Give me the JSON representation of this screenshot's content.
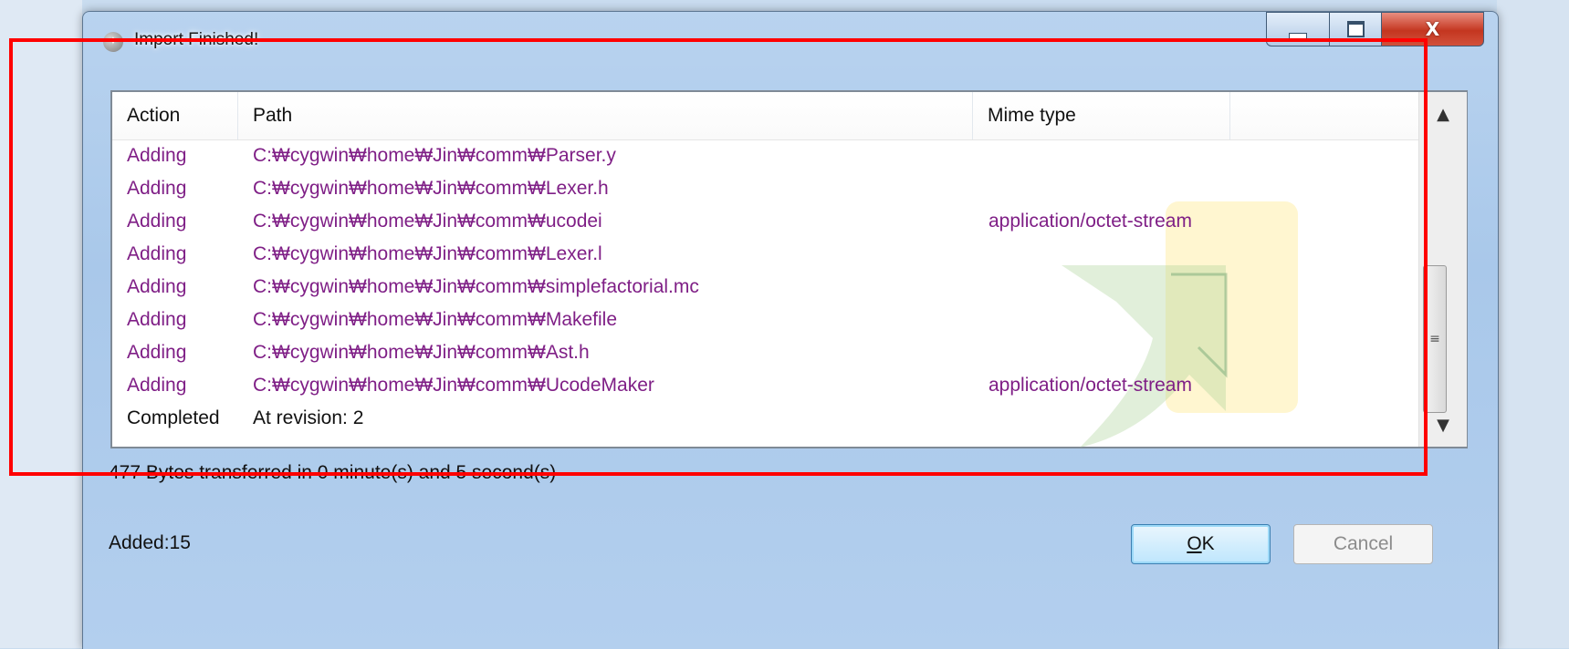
{
  "dialog": {
    "title": "Import Finished!",
    "close_glyph": "X"
  },
  "list": {
    "columns": [
      "Action",
      "Path",
      "Mime type"
    ],
    "rows": [
      {
        "action": "Adding",
        "path": "C:₩cygwin₩home₩Jin₩comm₩Parser.y",
        "mime": ""
      },
      {
        "action": "Adding",
        "path": "C:₩cygwin₩home₩Jin₩comm₩Lexer.h",
        "mime": ""
      },
      {
        "action": "Adding",
        "path": "C:₩cygwin₩home₩Jin₩comm₩ucodei",
        "mime": "application/octet-stream"
      },
      {
        "action": "Adding",
        "path": "C:₩cygwin₩home₩Jin₩comm₩Lexer.l",
        "mime": ""
      },
      {
        "action": "Adding",
        "path": "C:₩cygwin₩home₩Jin₩comm₩simplefactorial.mc",
        "mime": ""
      },
      {
        "action": "Adding",
        "path": "C:₩cygwin₩home₩Jin₩comm₩Makefile",
        "mime": ""
      },
      {
        "action": "Adding",
        "path": "C:₩cygwin₩home₩Jin₩comm₩Ast.h",
        "mime": ""
      },
      {
        "action": "Adding",
        "path": "C:₩cygwin₩home₩Jin₩comm₩UcodeMaker",
        "mime": "application/octet-stream"
      },
      {
        "action": "Completed",
        "path": "At revision: 2",
        "mime": ""
      }
    ],
    "row_color_adding": "#7f1f86",
    "row_color_completed": "#111111"
  },
  "status": {
    "transfer_text": "477 Bytes transferred in 0 minute(s) and 5 second(s)",
    "added_text": "Added:15"
  },
  "buttons": {
    "ok_label_underlined": "O",
    "ok_label_rest": "K",
    "cancel_label": "Cancel"
  },
  "icons": {
    "scroll_up": "scroll-up-icon",
    "scroll_down": "scroll-down-icon",
    "scroll_grip": "scroll-grip-icon",
    "window": "import-icon"
  },
  "colors": {
    "annotation": "#ff0000"
  }
}
